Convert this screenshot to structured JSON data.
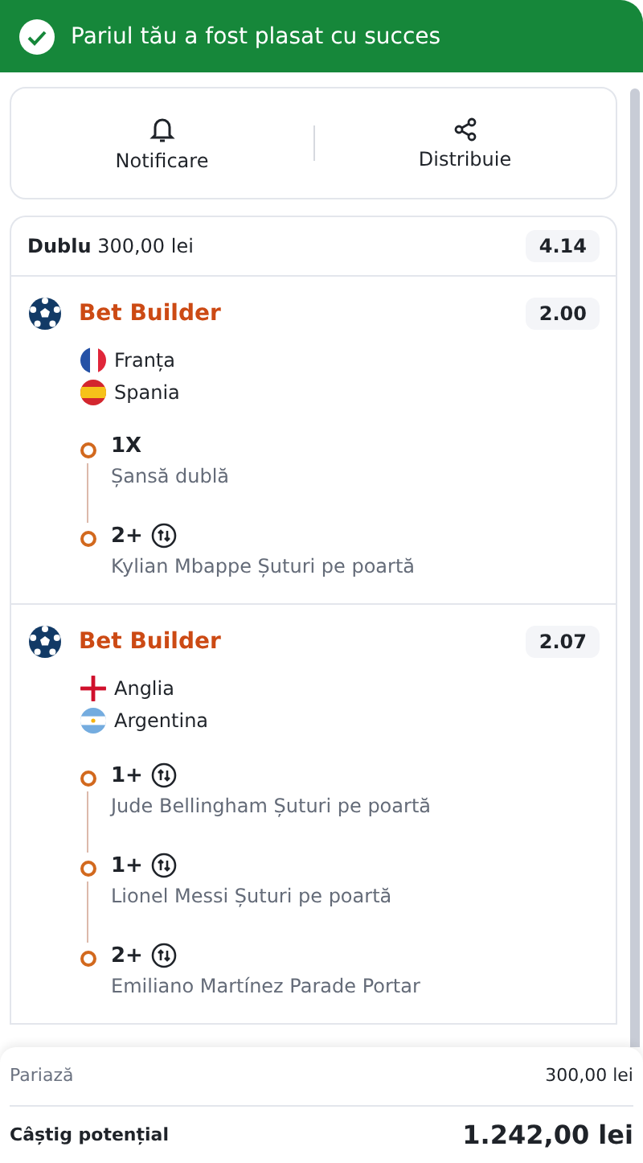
{
  "banner": {
    "message": "Pariul tău a fost plasat cu succes"
  },
  "actions": [
    {
      "kind": "bell",
      "label": "Notificare"
    },
    {
      "kind": "share",
      "label": "Distribuie"
    }
  ],
  "bet": {
    "type": "Dublu",
    "stake": "300,00 lei",
    "odds": "4.14",
    "events": [
      {
        "title": "Bet Builder",
        "odds": "2.00",
        "teams": [
          {
            "name": "Franța",
            "kind": "fr"
          },
          {
            "name": "Spania",
            "kind": "es"
          }
        ],
        "selections": [
          {
            "pick": "1X",
            "swap": false,
            "description": "Șansă dublă"
          },
          {
            "pick": "2+",
            "swap": true,
            "description": "Kylian Mbappe Șuturi pe poartă"
          }
        ]
      },
      {
        "title": "Bet Builder",
        "odds": "2.07",
        "teams": [
          {
            "name": "Anglia",
            "kind": "en"
          },
          {
            "name": "Argentina",
            "kind": "ar"
          }
        ],
        "selections": [
          {
            "pick": "1+",
            "swap": true,
            "description": "Jude Bellingham Șuturi pe poartă"
          },
          {
            "pick": "1+",
            "swap": true,
            "description": "Lionel Messi Șuturi pe poartă"
          },
          {
            "pick": "2+",
            "swap": true,
            "description": "Emiliano Martínez Parade Portar"
          }
        ]
      }
    ]
  },
  "footer": {
    "stake_label": "Pariază",
    "stake_value": "300,00 lei",
    "win_label": "Câștig potențial",
    "win_value": "1.242,00 lei"
  }
}
